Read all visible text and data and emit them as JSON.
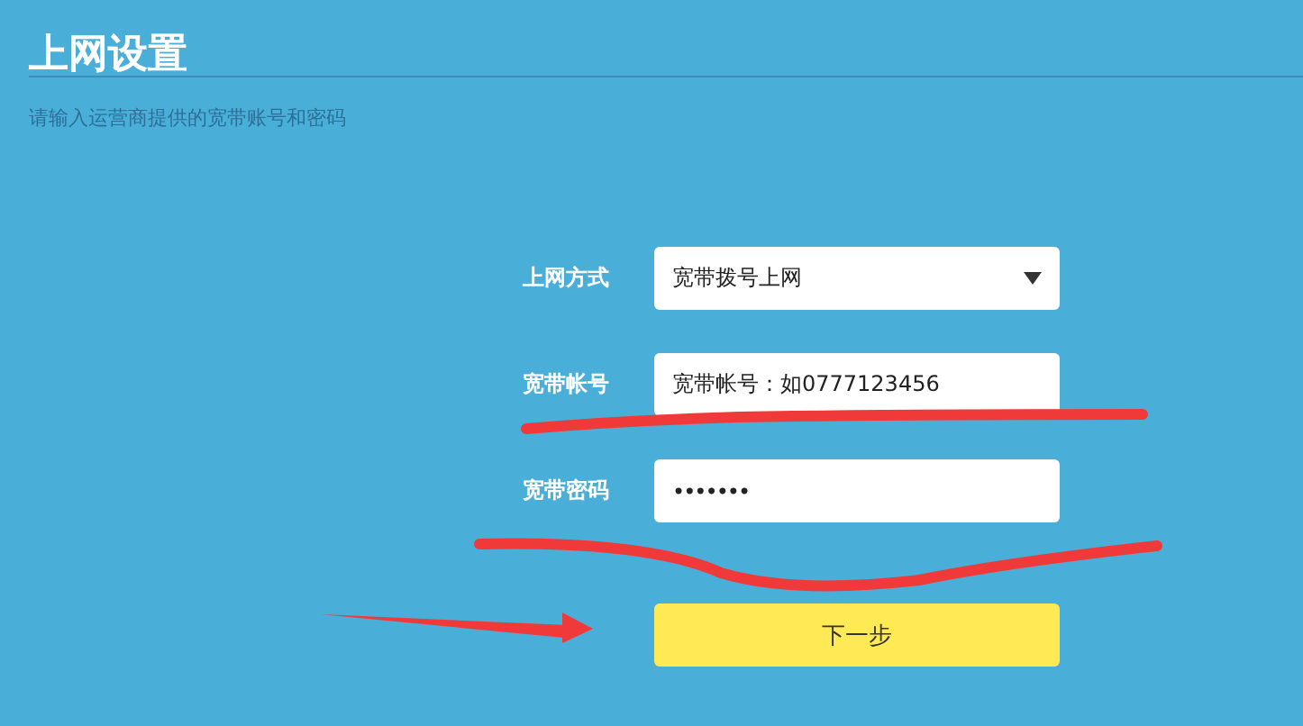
{
  "page": {
    "title": "上网设置",
    "subtitle": "请输入运营商提供的宽带账号和密码"
  },
  "form": {
    "fields": [
      {
        "kind": "select",
        "label": "上网方式",
        "value": "宽带拨号上网"
      },
      {
        "kind": "text",
        "label": "宽带帐号",
        "value": "宽带帐号：如0777123456"
      },
      {
        "kind": "password",
        "label": "宽带密码",
        "value": "•••••••"
      }
    ],
    "submit": "下一步"
  }
}
